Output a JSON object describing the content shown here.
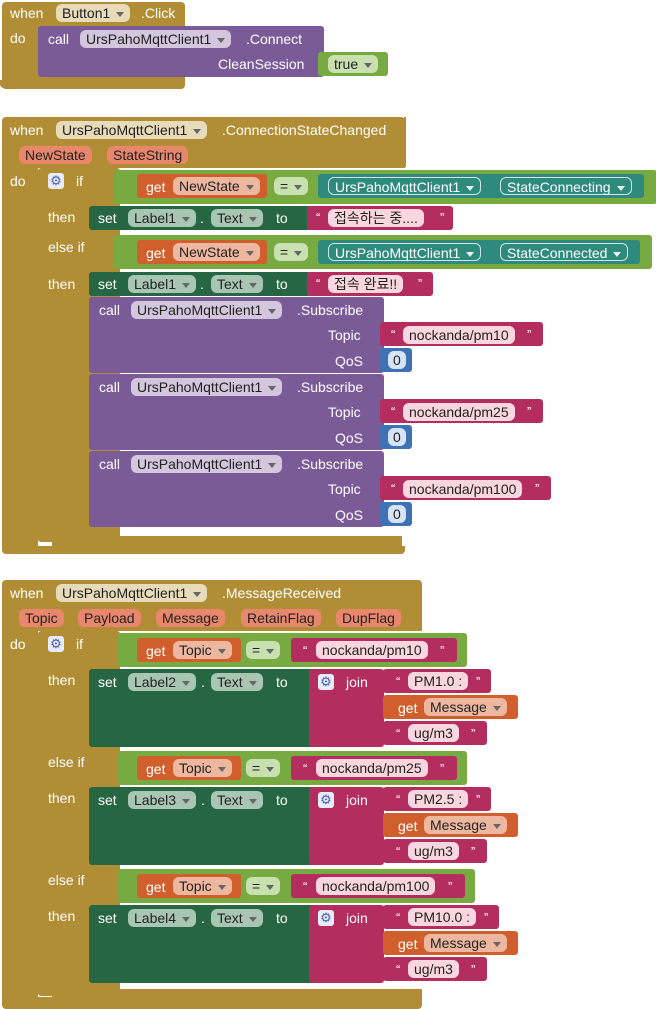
{
  "kw": {
    "when": "when",
    "do": "do",
    "call": "call",
    "set": "set",
    "to": "to",
    "get": "get",
    "if": "if",
    "then": "then",
    "else_if": "else if",
    "join": "join",
    "eq": "=",
    "dot": "."
  },
  "icons": {
    "mutator": "gear-icon",
    "dropdown": "chevron-down-icon"
  },
  "colors": {
    "event": "#b18e35",
    "procedure": "#7b5b97",
    "setter": "#266643",
    "logic": "#77ab41",
    "text": "#b32d5e",
    "math": "#3f71b5",
    "getter": "#d05f2d"
  },
  "block1": {
    "component": "Button1",
    "event": ".Click",
    "client": "UrsPahoMqttClient1",
    "method": ".Connect",
    "arg_label": "CleanSession",
    "arg_value": "true"
  },
  "block2": {
    "component": "UrsPahoMqttClient1",
    "event": ".ConnectionStateChanged",
    "params": [
      "NewState",
      "StateString"
    ],
    "cond1": {
      "var": "NewState",
      "client": "UrsPahoMqttClient1",
      "const": "StateConnecting"
    },
    "set1": {
      "target": "Label1",
      "prop": "Text",
      "text": "접속하는 중...."
    },
    "cond2": {
      "var": "NewState",
      "client": "UrsPahoMqttClient1",
      "const": "StateConnected"
    },
    "set2": {
      "target": "Label1",
      "prop": "Text",
      "text": "접속 완료!!"
    },
    "subscribe": {
      "client": "UrsPahoMqttClient1",
      "method": ".Subscribe",
      "topic_label": "Topic",
      "qos_label": "QoS"
    },
    "subs": [
      {
        "topic": "nockanda/pm10",
        "qos": "0"
      },
      {
        "topic": "nockanda/pm25",
        "qos": "0"
      },
      {
        "topic": "nockanda/pm100",
        "qos": "0"
      }
    ]
  },
  "block3": {
    "component": "UrsPahoMqttClient1",
    "event": ".MessageReceived",
    "params": [
      "Topic",
      "Payload",
      "Message",
      "RetainFlag",
      "DupFlag"
    ],
    "branches": [
      {
        "cond_var": "Topic",
        "cond_text": "nockanda/pm10",
        "label": "Label2",
        "prop": "Text",
        "prefix": "PM1.0 : ",
        "msg_var": "Message",
        "suffix": "ug/m3"
      },
      {
        "cond_var": "Topic",
        "cond_text": "nockanda/pm25",
        "label": "Label3",
        "prop": "Text",
        "prefix": "PM2.5 : ",
        "msg_var": "Message",
        "suffix": "ug/m3"
      },
      {
        "cond_var": "Topic",
        "cond_text": "nockanda/pm100",
        "label": "Label4",
        "prop": "Text",
        "prefix": "PM10.0 : ",
        "msg_var": "Message",
        "suffix": "ug/m3"
      }
    ]
  }
}
